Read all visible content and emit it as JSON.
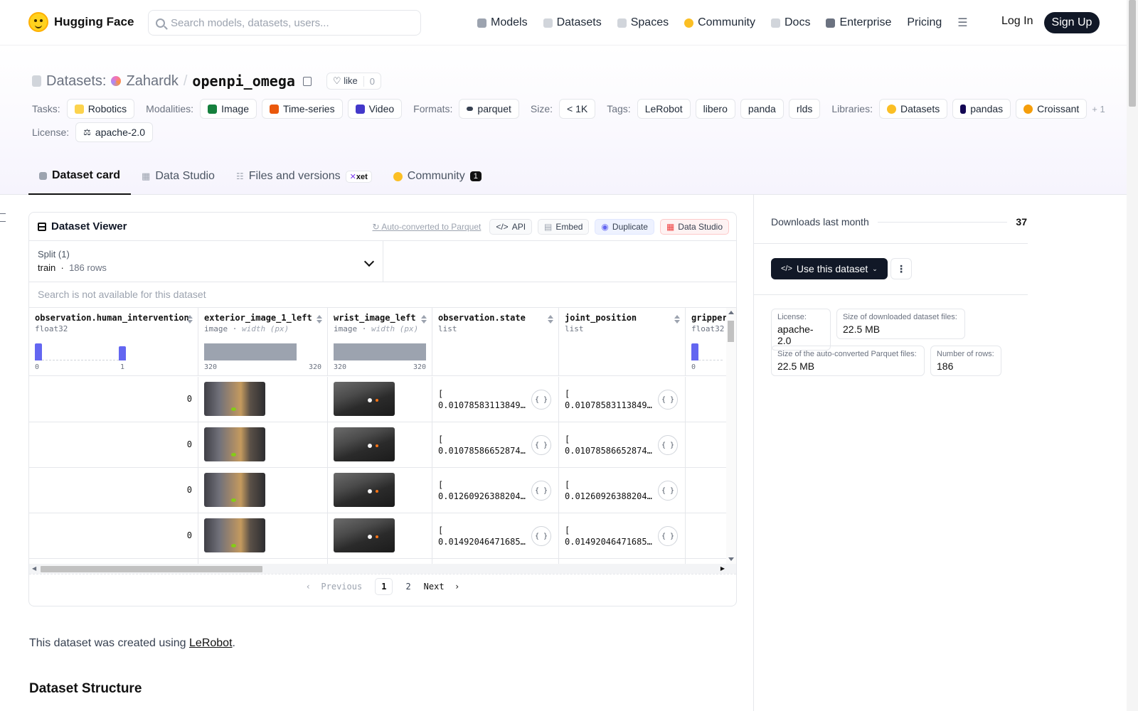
{
  "nav": {
    "brand": "Hugging Face",
    "search_placeholder": "Search models, datasets, users...",
    "links": [
      {
        "label": "Models",
        "color": "#6b7280"
      },
      {
        "label": "Datasets",
        "color": "#9ca3af"
      },
      {
        "label": "Spaces",
        "color": "#9ca3af"
      },
      {
        "label": "Community",
        "color": "#fbbf24"
      },
      {
        "label": "Docs",
        "color": "#9ca3af"
      },
      {
        "label": "Enterprise",
        "color": "#6b7280"
      },
      {
        "label": "Pricing"
      }
    ],
    "login": "Log In",
    "signup": "Sign Up"
  },
  "header": {
    "prefix": "Datasets:",
    "owner": "Zahardk",
    "sep": "/",
    "name": "openpi_omega",
    "like": "like",
    "like_count": "0",
    "tasks_label": "Tasks:",
    "tasks": [
      "Robotics"
    ],
    "modalities_label": "Modalities:",
    "modalities": [
      "Image",
      "Time-series",
      "Video"
    ],
    "formats_label": "Formats:",
    "formats": [
      "parquet"
    ],
    "size_label": "Size:",
    "size": [
      "< 1K"
    ],
    "tags_label": "Tags:",
    "tags": [
      "LeRobot",
      "libero",
      "panda",
      "rlds"
    ],
    "libraries_label": "Libraries:",
    "libraries": [
      "Datasets",
      "pandas",
      "Croissant"
    ],
    "more": "+ 1",
    "license_label": "License:",
    "license": "apache-2.0"
  },
  "tabs": [
    {
      "label": "Dataset card"
    },
    {
      "label": "Data Studio"
    },
    {
      "label": "Files and versions",
      "badge": "xet"
    },
    {
      "label": "Community",
      "badge": "1"
    }
  ],
  "viewer": {
    "title": "Dataset Viewer",
    "auto": "Auto-converted to Parquet",
    "api": "API",
    "embed": "Embed",
    "duplicate": "Duplicate",
    "datastudio": "Data Studio",
    "split_label": "Split (1)",
    "split_name": "train",
    "split_rows": "186 rows",
    "search_na": "Search is not available for this dataset",
    "columns": [
      {
        "name": "observation.human_intervention",
        "type": "float32",
        "min": "0",
        "max": "1"
      },
      {
        "name": "exterior_image_1_left",
        "type": "image",
        "sub": "width (px)",
        "min": "320",
        "max": "320"
      },
      {
        "name": "wrist_image_left",
        "type": "image",
        "sub": "width (px)",
        "min": "320",
        "max": "320"
      },
      {
        "name": "observation.state",
        "type": "list"
      },
      {
        "name": "joint_position",
        "type": "list"
      },
      {
        "name": "gripper",
        "type": "float32",
        "min": "0"
      }
    ],
    "rows": [
      {
        "hi": "0",
        "state": "[\n0.01078583113849…",
        "joint": "[\n0.01078583113849…"
      },
      {
        "hi": "0",
        "state": "[\n0.01078586652874…",
        "joint": "[\n0.01078586652874…"
      },
      {
        "hi": "0",
        "state": "[\n0.01260926388204…",
        "joint": "[\n0.01260926388204…"
      },
      {
        "hi": "0",
        "state": "[\n0.01492046471685…",
        "joint": "[\n0.01492046471685…"
      }
    ],
    "pager": {
      "prev": "Previous",
      "p1": "1",
      "p2": "2",
      "next": "Next"
    }
  },
  "body": {
    "intro_pre": "This dataset was created using ",
    "link": "LeRobot",
    "intro_post": ".",
    "h2": "Dataset Structure"
  },
  "sidebar": {
    "downloads_label": "Downloads last month",
    "downloads": "37",
    "use": "Use this dataset",
    "meta": [
      {
        "k": "License:",
        "v": "apache-2.0"
      },
      {
        "k": "Size of downloaded dataset files:",
        "v": "22.5 MB"
      },
      {
        "k": "Size of the auto-converted Parquet files:",
        "v": "22.5 MB"
      },
      {
        "k": "Number of rows:",
        "v": "186"
      }
    ]
  }
}
